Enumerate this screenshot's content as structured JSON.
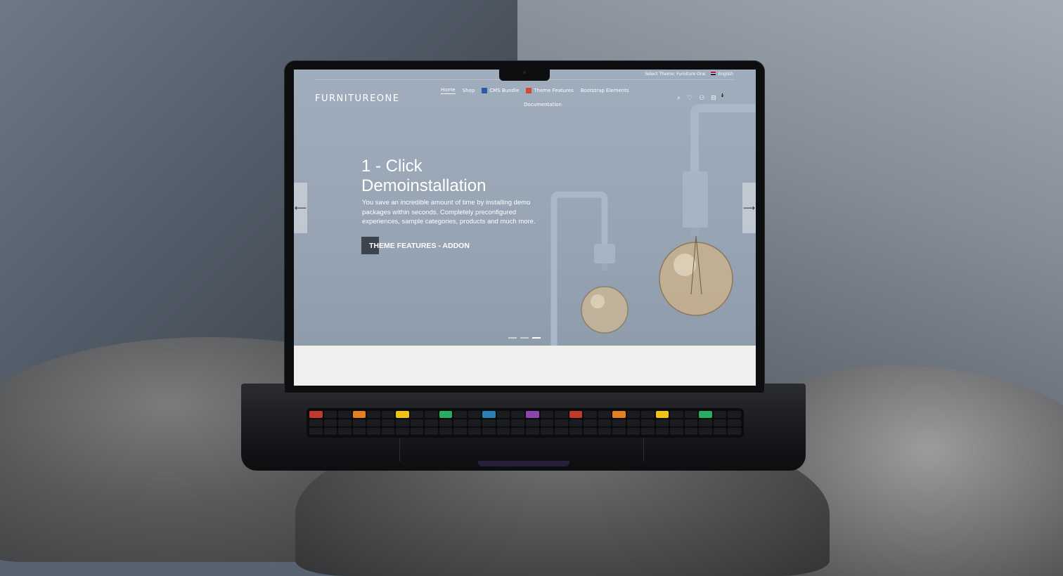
{
  "site": {
    "logo": "FURNITUREONE",
    "topbar": {
      "theme_select": "Select Theme: Furniture One",
      "language": "English"
    },
    "nav": {
      "home": "Home",
      "shop": "Shop",
      "cms_bundle": "CMS Bundle",
      "theme_features": "Theme Features",
      "bootstrap_elements": "Bootstrap Elements",
      "documentation": "Documentation"
    },
    "cart_count": "0",
    "icons": [
      "search-icon",
      "heart-icon",
      "user-icon",
      "cart-icon"
    ]
  },
  "slider": {
    "title_line1": "1 - Click",
    "title_line2": "Demoinstallation",
    "description": "You save an incredible amount of time by installing demo packages within seconds. Completely preconfigured experiences, sample categories, products and much more.",
    "cta": "THEME FEATURES - ADDON",
    "prev": "⟵",
    "next": "⟶",
    "slides_total": 3,
    "slide_active": 3
  },
  "colors": {
    "hero_bg": "#97a5b5",
    "accent_square": "#3d444d",
    "cms_icon": "#2b5aa8",
    "theme_icon": "#d6453d"
  }
}
